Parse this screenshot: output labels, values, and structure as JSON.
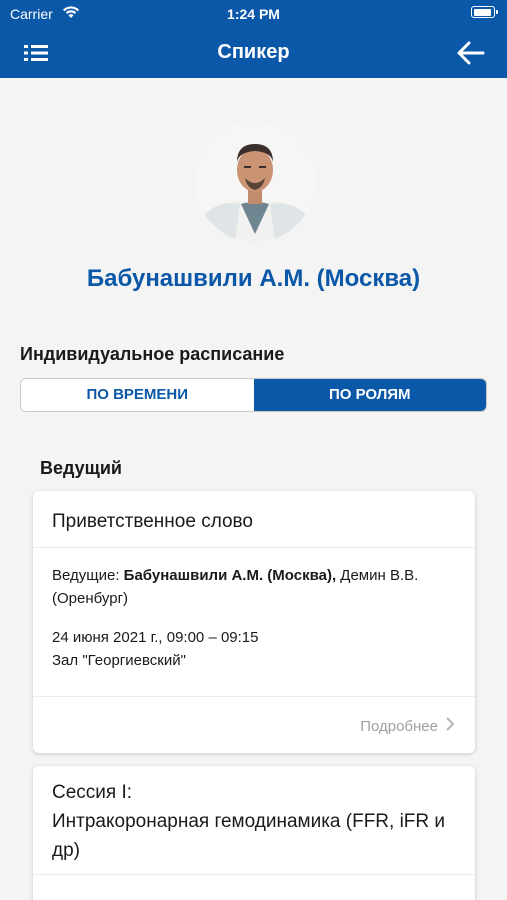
{
  "status_bar": {
    "carrier": "Carrier",
    "time": "1:24 PM"
  },
  "nav": {
    "title": "Спикер",
    "menu_icon": "list-menu-icon",
    "back_icon": "arrow-left-icon"
  },
  "speaker": {
    "name": "Бабунашвили А.М. (Москва)"
  },
  "schedule": {
    "heading": "Индивидуальное расписание",
    "tabs": [
      {
        "label": "ПО ВРЕМЕНИ",
        "active": false
      },
      {
        "label": "ПО РОЛЯМ",
        "active": true
      }
    ]
  },
  "role_section": {
    "label": "Ведущий"
  },
  "sessions": [
    {
      "title": "Приветственное слово",
      "hosts_prefix": "Ведущие: ",
      "hosts_bold": "Бабунашвили А.М. (Москва),",
      "hosts_rest": " Демин В.В. (Оренбург)",
      "datetime": "24 июня 2021 г., 09:00 – 09:15",
      "hall": "Зал \"Георгиевский\"",
      "details_label": "Подробнее"
    },
    {
      "title_line1": "Сессия I:",
      "title_line2": "Интракоронарная гемодинамика (FFR, iFR и др)"
    }
  ],
  "colors": {
    "brand": "#0b57a8",
    "background": "#f4f4f4",
    "muted": "#a0a0a0"
  }
}
